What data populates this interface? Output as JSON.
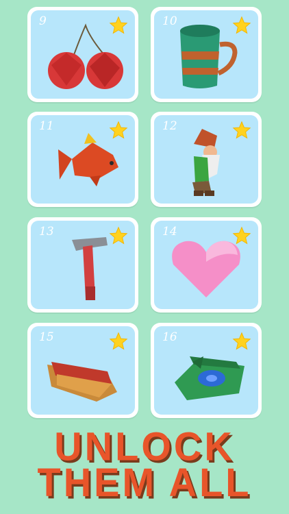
{
  "cards": [
    {
      "number": "9",
      "item": "cherries"
    },
    {
      "number": "10",
      "item": "mug"
    },
    {
      "number": "11",
      "item": "fish"
    },
    {
      "number": "12",
      "item": "gnome"
    },
    {
      "number": "13",
      "item": "hammer"
    },
    {
      "number": "14",
      "item": "heart"
    },
    {
      "number": "15",
      "item": "hotdog"
    },
    {
      "number": "16",
      "item": "telephone"
    }
  ],
  "banner": {
    "line1": "UNLOCK",
    "line2": "THEM ALL"
  },
  "colors": {
    "background": "#a6e6c7",
    "card": "#b7e6fb",
    "star": "#ffd21f",
    "banner": "#e8552a"
  }
}
